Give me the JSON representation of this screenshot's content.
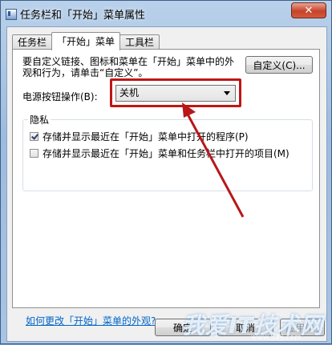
{
  "window": {
    "title": "任务栏和「开始」菜单属性",
    "close_label": "✕"
  },
  "tabs": [
    {
      "label": "任务栏",
      "active": false
    },
    {
      "label": "「开始」菜单",
      "active": true
    },
    {
      "label": "工具栏",
      "active": false
    }
  ],
  "panel": {
    "description": "要自定义链接、图标和菜单在「开始」菜单中的外观和行为，请单击“自定义”。",
    "customize_button": "自定义(C)...",
    "power_label": "电源按钮操作(B):",
    "power_value": "关机",
    "privacy": {
      "title": "隐私",
      "items": [
        {
          "label": "存储并显示最近在「开始」菜单中打开的程序(P)",
          "checked": true
        },
        {
          "label": "存储并显示最近在「开始」菜单和任务栏中打开的项目(M)",
          "checked": false
        }
      ]
    },
    "help_link": "如何更改「开始」菜单的外观?"
  },
  "buttons": {
    "ok": "确定",
    "cancel": "取消",
    "apply": "应用(A)"
  },
  "watermark": {
    "text": "我爱IT技术网",
    "sub": "www.52ij.com"
  },
  "colors": {
    "highlight": "#c01515",
    "link": "#0066cc"
  }
}
